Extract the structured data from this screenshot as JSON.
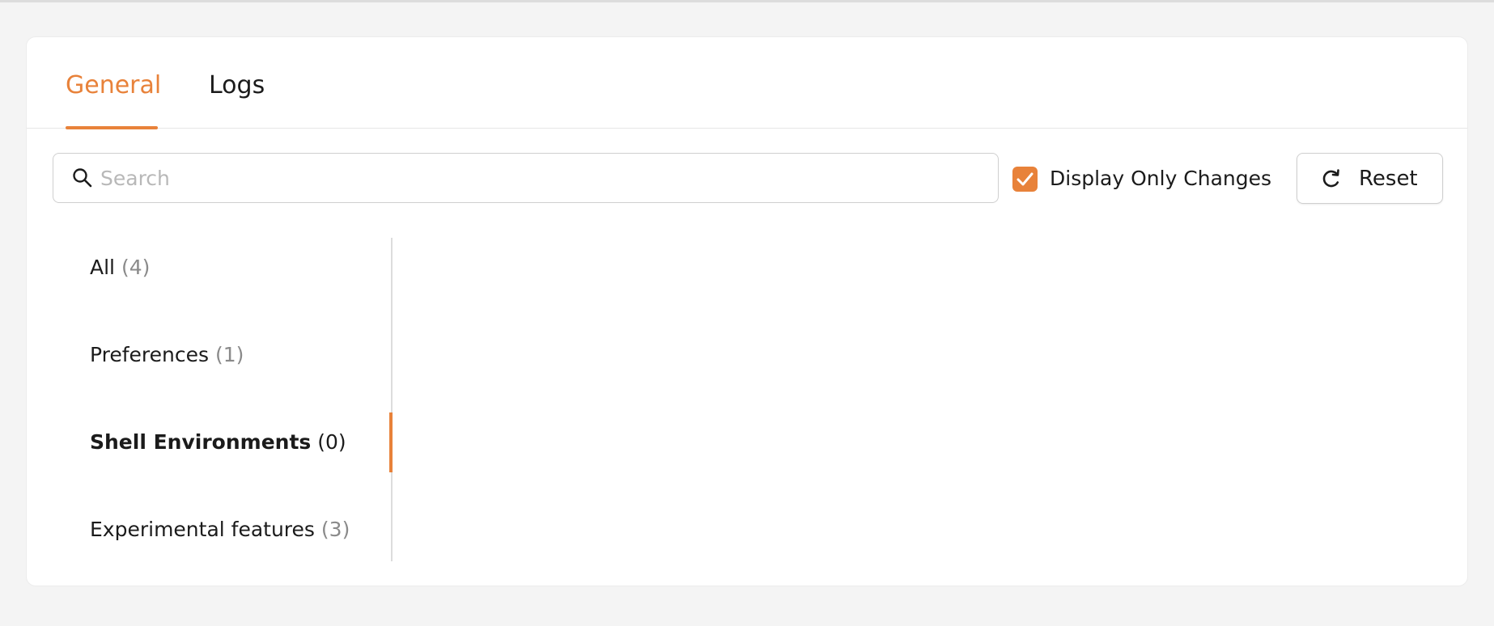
{
  "tabs": [
    {
      "label": "General",
      "active": true
    },
    {
      "label": "Logs",
      "active": false
    }
  ],
  "search": {
    "placeholder": "Search",
    "value": ""
  },
  "filter": {
    "label": "Display Only Changes",
    "checked": true
  },
  "reset": {
    "label": "Reset"
  },
  "sidebar": {
    "items": [
      {
        "name": "All",
        "count": "(4)"
      },
      {
        "name": "Preferences",
        "count": "(1)"
      },
      {
        "name": "Shell Environments",
        "count": "(0)",
        "active": true
      },
      {
        "name": "Experimental features",
        "count": "(3)"
      }
    ]
  },
  "colors": {
    "accent": "#e8823a",
    "text": "#1b1b1b",
    "muted": "#8a8a8a",
    "background": "#f4f4f4"
  }
}
